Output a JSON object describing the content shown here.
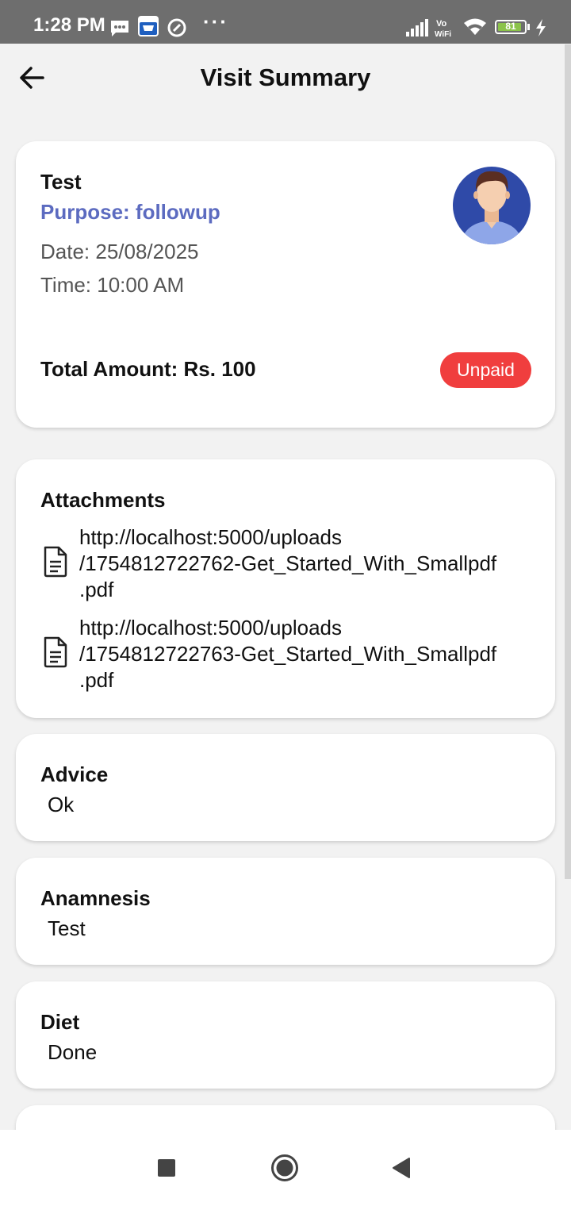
{
  "status_bar": {
    "time": "1:28 PM",
    "battery_level": "81",
    "battery_percent": 81,
    "icons": [
      "message-icon",
      "amazon-shopping-icon",
      "vpn-icon",
      "more-dots-icon",
      "signal-icon",
      "vowifi-icon",
      "wifi-icon",
      "battery-icon",
      "charging-icon"
    ]
  },
  "header": {
    "back_icon": "arrow-left-icon",
    "title": "Visit Summary"
  },
  "visit": {
    "name": "Test",
    "purpose": "Purpose: followup",
    "date": "Date: 25/08/2025",
    "time": "Time: 10:00 AM",
    "total_amount": "Total Amount: Rs. 100",
    "payment_status": "Unpaid",
    "status_color": "#f03e3e",
    "accent_color": "#5c6bc0"
  },
  "attachments": {
    "title": "Attachments",
    "files": [
      {
        "line1": "http://localhost:5000/uploads",
        "line2": "/1754812722762-Get_Started_With_Smallpdf",
        "line3": ".pdf"
      },
      {
        "line1": "http://localhost:5000/uploads",
        "line2": "/1754812722763-Get_Started_With_Smallpdf",
        "line3": ".pdf"
      }
    ]
  },
  "sections": {
    "advice": {
      "title": "Advice",
      "text": "Ok"
    },
    "anamnesis": {
      "title": "Anamnesis",
      "text": "Test"
    },
    "diet": {
      "title": "Diet",
      "text": "Done"
    }
  },
  "nav": {
    "recents_icon": "square-icon",
    "home_icon": "circle-icon",
    "back_icon": "triangle-back-icon"
  }
}
